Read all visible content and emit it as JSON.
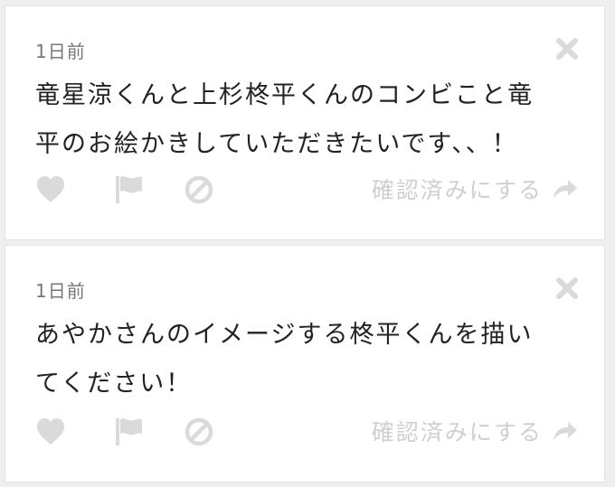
{
  "colors": {
    "background": "#efefef",
    "card": "#ffffff",
    "icon": "#dadada",
    "text": "#222222",
    "muted": "#777777"
  },
  "messages": [
    {
      "timestamp": "1日前",
      "text": "竜星涼くんと上杉柊平くんのコンビこと竜\n平のお絵かきしていただきたいです、、！",
      "mark_read_label": "確認済みにする",
      "icons": [
        "close-icon",
        "heart-icon",
        "flag-icon",
        "block-icon",
        "share-arrow-icon"
      ]
    },
    {
      "timestamp": "1日前",
      "text": "あやかさんのイメージする柊平くんを描い\nてください！",
      "mark_read_label": "確認済みにする",
      "icons": [
        "close-icon",
        "heart-icon",
        "flag-icon",
        "block-icon",
        "share-arrow-icon"
      ]
    }
  ]
}
